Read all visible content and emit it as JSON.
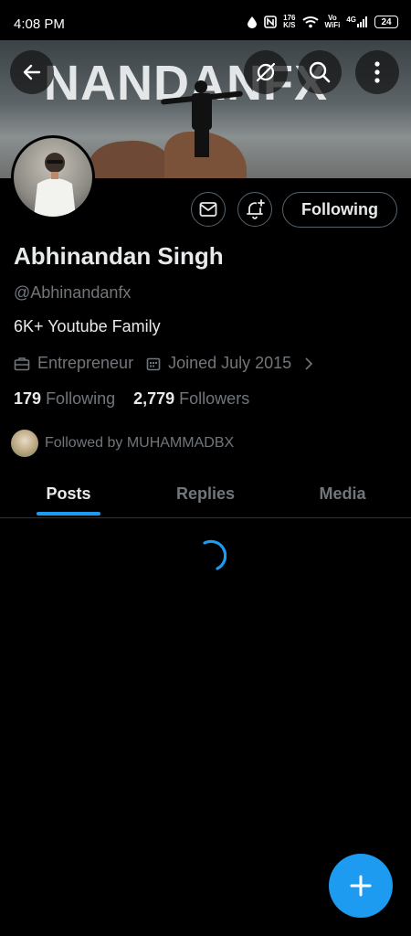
{
  "status_bar": {
    "time": "4:08 PM",
    "net_speed_top": "176",
    "net_speed_unit": "K/S",
    "vowifi_top": "Vo",
    "vowifi_bottom": "WiFi",
    "network": "4G",
    "battery": "24"
  },
  "banner": {
    "text": "NANDANFX",
    "icons": [
      "back-arrow-icon",
      "grok-icon",
      "search-icon",
      "more-vertical-icon"
    ]
  },
  "profile": {
    "name": "Abhinandan Singh",
    "handle": "@Abhinandanfx",
    "bio": "6K+ Youtube Family",
    "profession": "Entrepreneur",
    "joined": "Joined July 2015",
    "following_count": "179",
    "following_label": "Following",
    "followers_count": "2,779",
    "followers_label": "Followers",
    "followed_by": "Followed by MUHAMMADBX",
    "follow_button": "Following"
  },
  "tabs": [
    {
      "label": "Posts",
      "active": true
    },
    {
      "label": "Replies",
      "active": false
    },
    {
      "label": "Media",
      "active": false
    }
  ],
  "colors": {
    "accent": "#1d9bf0",
    "background": "#000000",
    "muted_text": "#71767b",
    "primary_text": "#e7e9ea"
  }
}
